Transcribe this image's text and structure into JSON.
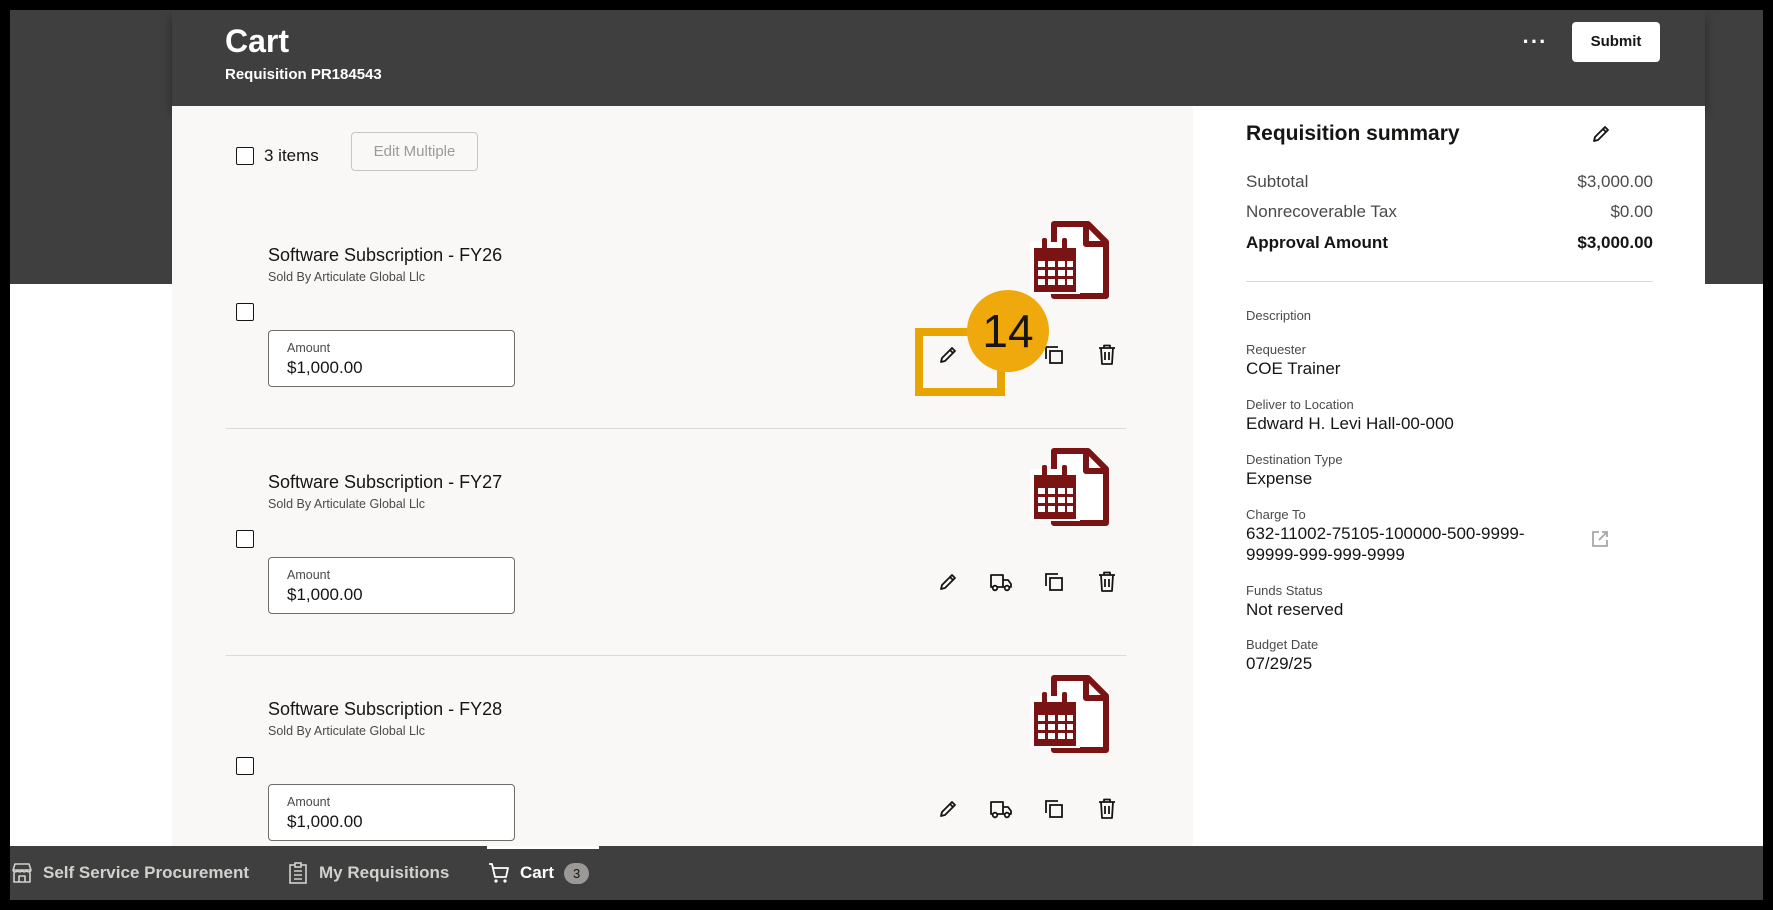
{
  "header": {
    "title": "Cart",
    "subtitle": "Requisition PR184543",
    "more_label": "···",
    "more_icon": "ellipsis-icon",
    "submit_label": "Submit"
  },
  "cart": {
    "items_count_label": "3 items",
    "edit_multiple_label": "Edit Multiple",
    "amount_label": "Amount",
    "items": [
      {
        "name": "Software Subscription - FY26",
        "seller": "Sold By Articulate Global Llc",
        "amount": "$1,000.00"
      },
      {
        "name": "Software Subscription - FY27",
        "seller": "Sold By Articulate Global Llc",
        "amount": "$1,000.00"
      },
      {
        "name": "Software Subscription - FY28",
        "seller": "Sold By Articulate Global Llc",
        "amount": "$1,000.00"
      }
    ],
    "item_image_icon": "calendar-document-icon",
    "item_image_color": "#7a1414",
    "actions": [
      "pencil-icon",
      "truck-icon",
      "duplicate-icon",
      "trash-icon"
    ]
  },
  "annotation": {
    "step_number": "14",
    "color": "#e8a400"
  },
  "summary": {
    "title": "Requisition summary",
    "subtotal_label": "Subtotal",
    "subtotal_value": "$3,000.00",
    "tax_label": "Nonrecoverable Tax",
    "tax_value": "$0.00",
    "approval_label": "Approval Amount",
    "approval_value": "$3,000.00",
    "description_label": "Description",
    "requester_label": "Requester",
    "requester_value": "COE Trainer",
    "location_label": "Deliver to Location",
    "location_value": "Edward H. Levi Hall-00-000",
    "destination_label": "Destination Type",
    "destination_value": "Expense",
    "charge_label": "Charge To",
    "charge_value_line1": "632-11002-75105-100000-500-9999-",
    "charge_value_line2": "99999-999-999-9999",
    "funds_label": "Funds Status",
    "funds_value": "Not reserved",
    "budget_label": "Budget Date",
    "budget_value": "07/29/25"
  },
  "bottom_nav": {
    "items": [
      {
        "label": "Self Service Procurement",
        "icon": "storefront-icon"
      },
      {
        "label": "My Requisitions",
        "icon": "clipboard-list-icon"
      },
      {
        "label": "Cart",
        "icon": "cart-icon",
        "badge": "3"
      }
    ]
  }
}
